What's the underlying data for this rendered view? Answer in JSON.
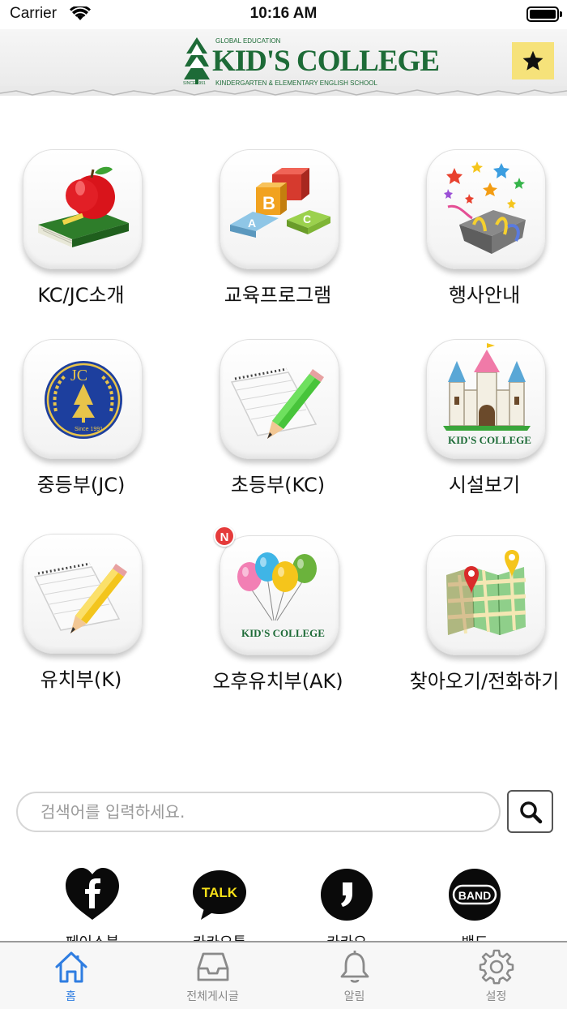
{
  "status_bar": {
    "carrier": "Carrier",
    "time": "10:16 AM"
  },
  "header": {
    "logo": {
      "name": "KID'S COLLEGE",
      "tagline_top": "GLOBAL EDUCATION",
      "tagline_bottom": "KINDERGARTEN & ELEMENTARY ENGLISH SCHOOL",
      "since": "SINCE 1991"
    },
    "favorite_icon": "star-icon"
  },
  "menu": [
    {
      "label": "KC/JC소개",
      "icon": "apple-book-icon"
    },
    {
      "label": "교육프로그램",
      "icon": "abc-blocks-icon"
    },
    {
      "label": "행사안내",
      "icon": "gift-box-stars-icon"
    },
    {
      "label": "중등부(JC)",
      "icon": "jc-emblem-icon"
    },
    {
      "label": "초등부(KC)",
      "icon": "green-pencil-notepad-icon"
    },
    {
      "label": "시설보기",
      "icon": "castle-icon"
    },
    {
      "label": "유치부(K)",
      "icon": "yellow-pencil-notepad-icon"
    },
    {
      "label": "오후유치부(AK)",
      "icon": "balloons-icon",
      "badge": "N"
    },
    {
      "label": "찾아오기/전화하기",
      "icon": "map-pins-icon"
    }
  ],
  "search": {
    "placeholder": "검색어를 입력하세요.",
    "value": ""
  },
  "social": [
    {
      "label": "페이스북",
      "icon": "facebook-icon"
    },
    {
      "label": "카카오톡",
      "icon": "kakaotalk-icon"
    },
    {
      "label": "카카오",
      "icon": "kakaostory-icon"
    },
    {
      "label": "밴드",
      "icon": "band-icon"
    }
  ],
  "tabs": [
    {
      "label": "홈",
      "icon": "home-icon",
      "active": true
    },
    {
      "label": "전체게시글",
      "icon": "inbox-icon",
      "active": false
    },
    {
      "label": "알림",
      "icon": "bell-icon",
      "active": false
    },
    {
      "label": "설정",
      "icon": "gear-icon",
      "active": false
    }
  ],
  "colors": {
    "brand_green": "#1d6b37",
    "favorite_bg": "#f6e27a",
    "active_tab": "#2f7de1",
    "badge": "#e53b3b"
  }
}
